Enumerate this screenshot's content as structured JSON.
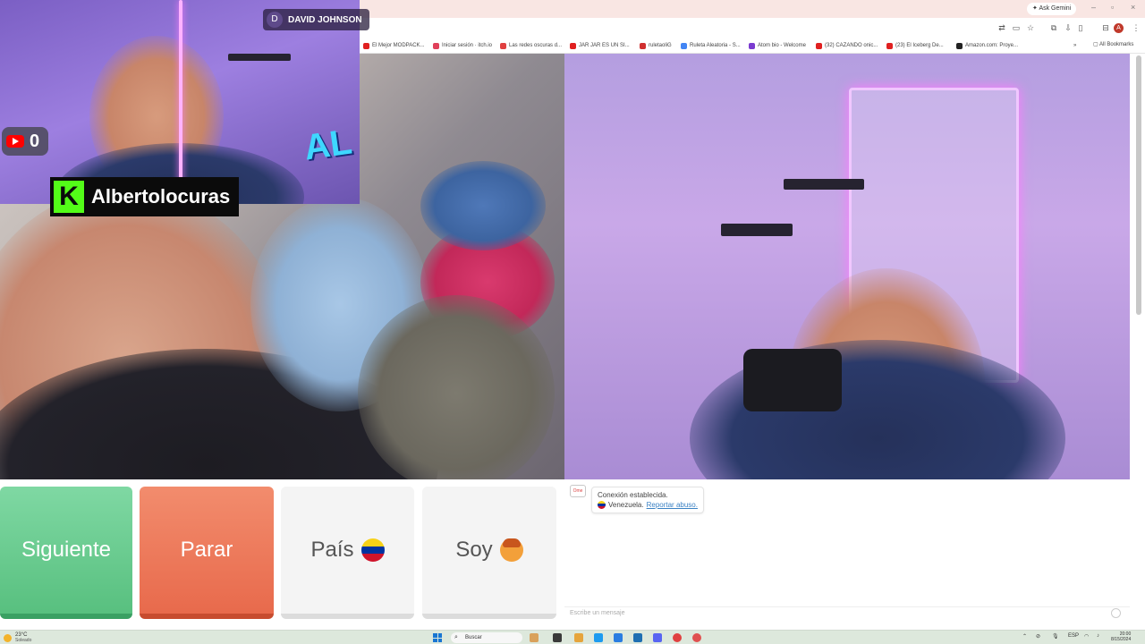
{
  "browser": {
    "ask_gemini": "Ask Gemini",
    "all_bookmarks": "All Bookmarks",
    "profile_initial": "A",
    "bookmarks": [
      {
        "label": "El Mejor MODPACK...",
        "color": "#e02020"
      },
      {
        "label": "Iniciar sesión · itch.io",
        "color": "#e0405a"
      },
      {
        "label": "Las redes oscuras d...",
        "color": "#e04040"
      },
      {
        "label": "JAR JAR ES UN SI...",
        "color": "#e02020"
      },
      {
        "label": "ruletaoliG",
        "color": "#d03030"
      },
      {
        "label": "Ruleta Aleatoria - S...",
        "color": "#4285f4"
      },
      {
        "label": "Atom bio - Welcome",
        "color": "#7a3bd0"
      },
      {
        "label": "(32) CAZANDO onic...",
        "color": "#e02020"
      },
      {
        "label": "(23) El Iceberg De...",
        "color": "#e02020"
      },
      {
        "label": "Amazon.com: Proye...",
        "color": "#222222"
      }
    ]
  },
  "overlay": {
    "avatar_initial": "D",
    "viewer_name": "DAVID JOHNSON",
    "youtube_count": "0",
    "kick_letter": "K",
    "streamer_name": "Albertolocuras",
    "logo_text": "AL"
  },
  "controls": {
    "next_label": "Siguiente",
    "stop_label": "Parar",
    "country_label": "País",
    "soy_label": "Soy"
  },
  "chat": {
    "logo_text": "Ome",
    "status": "Conexión establecida.",
    "country": "Venezuela.",
    "report_link": "Reportar abuso.",
    "input_placeholder": "Escribe un mensaje"
  },
  "taskbar": {
    "temperature": "23°C",
    "condition": "Soleado",
    "search_label": "Buscar",
    "language": "ESP",
    "time": "20:00",
    "date": "8/15/2024"
  },
  "colors": {
    "next": "#58c07f",
    "stop": "#e86a4c",
    "kick_green": "#53fc18",
    "venezuela": [
      "#f7d117",
      "#0033a0",
      "#cf142b"
    ]
  }
}
